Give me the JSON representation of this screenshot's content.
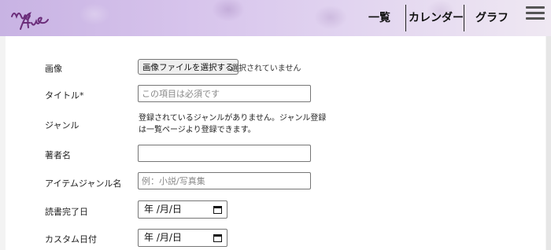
{
  "header": {
    "logo_text": "my fave",
    "nav": [
      {
        "label": "一覧"
      },
      {
        "label": "カレンダー"
      },
      {
        "label": "グラフ"
      }
    ],
    "menu_icon": "hamburger-icon"
  },
  "form": {
    "image": {
      "label": "画像",
      "button_label": "画像ファイルを選択する",
      "status": "選択されていません"
    },
    "title": {
      "label": "タイトル*",
      "placeholder": "この項目は必須です"
    },
    "genre": {
      "label": "ジャンル",
      "note_line1": "登録されているジャンルがありません。ジャンル登録",
      "note_line2": "は一覧ページより登録できます。"
    },
    "author": {
      "label": "著者名",
      "value": ""
    },
    "item_genre": {
      "label": "アイテムジャンル名",
      "placeholder": "例：小説/写真集"
    },
    "read_date": {
      "label": "読書完了日",
      "display": "年 /月/日"
    },
    "custom_date": {
      "label": "カスタム日付",
      "display": "年 /月/日"
    }
  },
  "colors": {
    "header_start": "#c8b3e3",
    "header_end": "#efe8f2",
    "logo": "#6b2d7a"
  }
}
